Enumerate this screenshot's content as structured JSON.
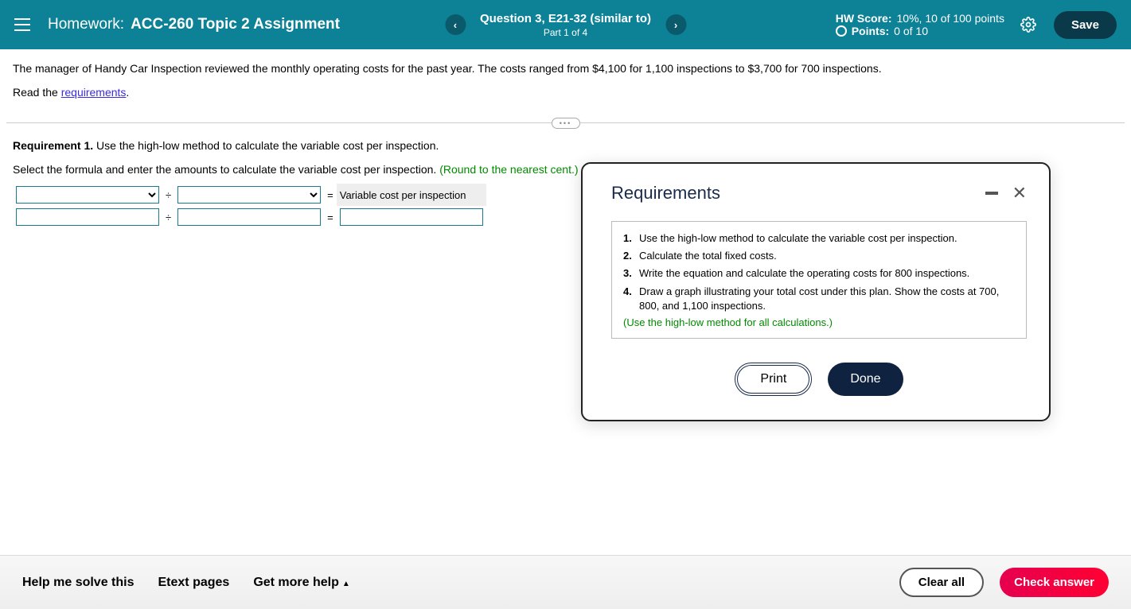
{
  "header": {
    "hw_label": "Homework:",
    "hw_title": "ACC-260 Topic 2 Assignment",
    "question_title": "Question 3, E21-32 (similar to)",
    "question_part": "Part 1 of 4",
    "hw_score_label": "HW Score:",
    "hw_score_value": "10%, 10 of 100 points",
    "points_label": "Points:",
    "points_value": "0 of 10",
    "save_label": "Save"
  },
  "problem": {
    "text": "The manager of Handy Car Inspection reviewed the monthly operating costs for the past year. The costs ranged from $4,100 for 1,100 inspections to $3,700 for 700 inspections.",
    "read_prefix": "Read the ",
    "read_link": "requirements",
    "read_suffix": "."
  },
  "work": {
    "req_label": "Requirement 1.",
    "req_text": " Use the high-low method to calculate the variable cost per inspection.",
    "instruction": "Select the formula and enter the amounts to calculate the variable cost per inspection. ",
    "round_note": "(Round to the nearest cent.)",
    "op_divide": "÷",
    "op_equals": "=",
    "result_label": "Variable cost per inspection"
  },
  "modal": {
    "title": "Requirements",
    "items": [
      "Use the high-low method to calculate the variable cost per inspection.",
      "Calculate the total fixed costs.",
      "Write the equation and calculate the operating costs for 800 inspections.",
      "Draw a graph illustrating your total cost under this plan. Show the costs at 700, 800, and 1,100 inspections."
    ],
    "note": "(Use the high-low method for all calculations.)",
    "print_label": "Print",
    "done_label": "Done"
  },
  "footer": {
    "help": "Help me solve this",
    "etext": "Etext pages",
    "more": "Get more help",
    "clear": "Clear all",
    "check": "Check answer"
  }
}
